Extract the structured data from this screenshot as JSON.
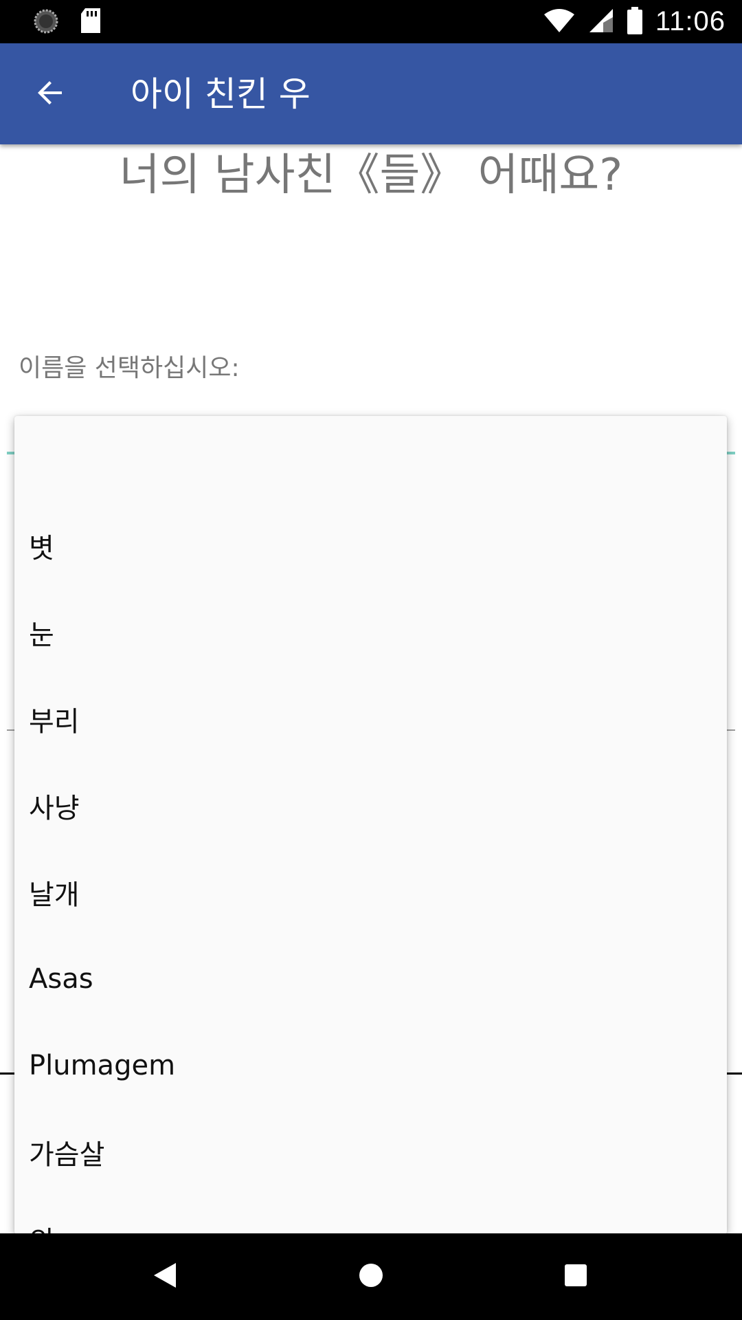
{
  "status_bar": {
    "time": "11:06",
    "icons": [
      "sync-icon",
      "sd-card-icon",
      "wifi-icon",
      "signal-icon",
      "battery-icon"
    ]
  },
  "app_bar": {
    "title": "아이 친킨 우",
    "back_icon": "arrow-back-icon",
    "color": "#3656a3"
  },
  "main": {
    "question": "너의 남사친《들》 어때요?",
    "prompt": "이름을 선택하십시오:"
  },
  "dropdown": {
    "items": [
      {
        "label": ""
      },
      {
        "label": "볏"
      },
      {
        "label": "눈"
      },
      {
        "label": "부리"
      },
      {
        "label": "사냥"
      },
      {
        "label": "날개"
      },
      {
        "label": "Asas"
      },
      {
        "label": "Plumagem"
      },
      {
        "label": "가슴살"
      },
      {
        "label": "의"
      }
    ]
  },
  "nav_bar": {
    "icons": [
      "nav-back-icon",
      "nav-home-icon",
      "nav-recents-icon"
    ]
  }
}
